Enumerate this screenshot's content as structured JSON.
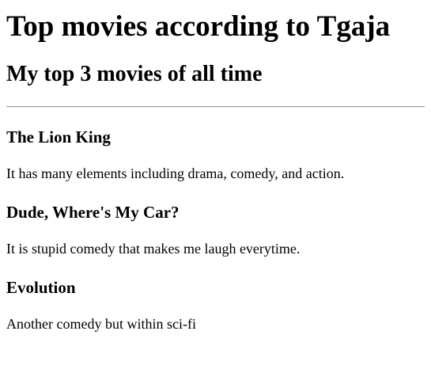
{
  "header": {
    "title": "Top movies according to Tgaja",
    "subtitle": "My top 3 movies of all time"
  },
  "movies": [
    {
      "title": "The Lion King",
      "description": "It has many elements including drama, comedy, and action."
    },
    {
      "title": "Dude, Where's My Car?",
      "description": "It is stupid comedy that makes me laugh everytime."
    },
    {
      "title": "Evolution",
      "description": "Another comedy but within sci-fi"
    }
  ]
}
